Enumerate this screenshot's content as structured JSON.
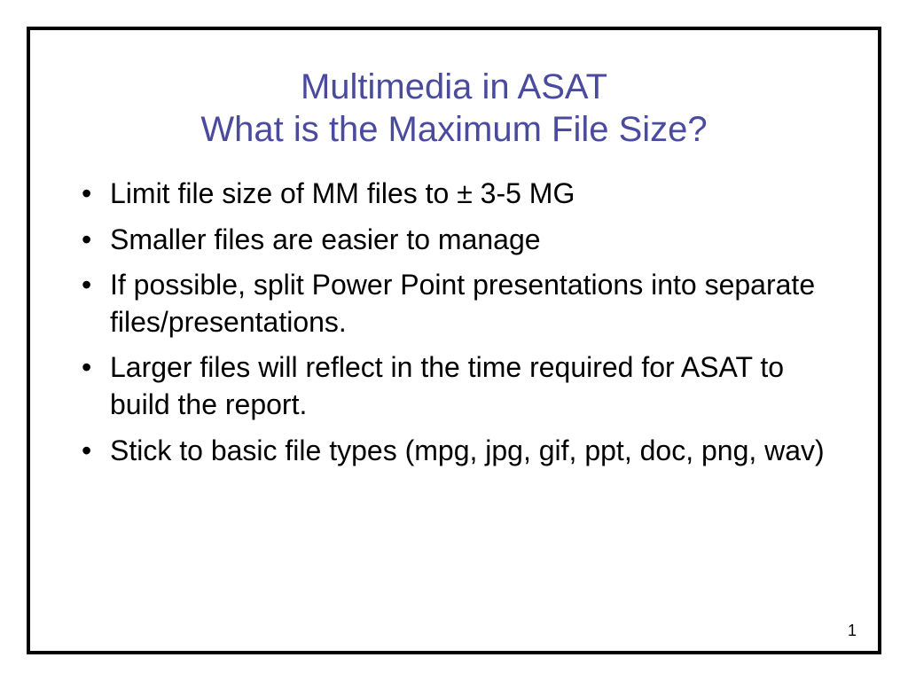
{
  "title": {
    "line1": "Multimedia in ASAT",
    "line2": "What is the Maximum File Size?"
  },
  "bullets": [
    "Limit file size of MM files to ± 3-5 MG",
    "Smaller files are easier to manage",
    "If possible, split Power Point presentations into separate files/presentations.",
    "Larger files will reflect in the time required for ASAT to build the report.",
    "Stick to basic file types (mpg, jpg, gif, ppt, doc, png, wav)"
  ],
  "pageNumber": "1"
}
